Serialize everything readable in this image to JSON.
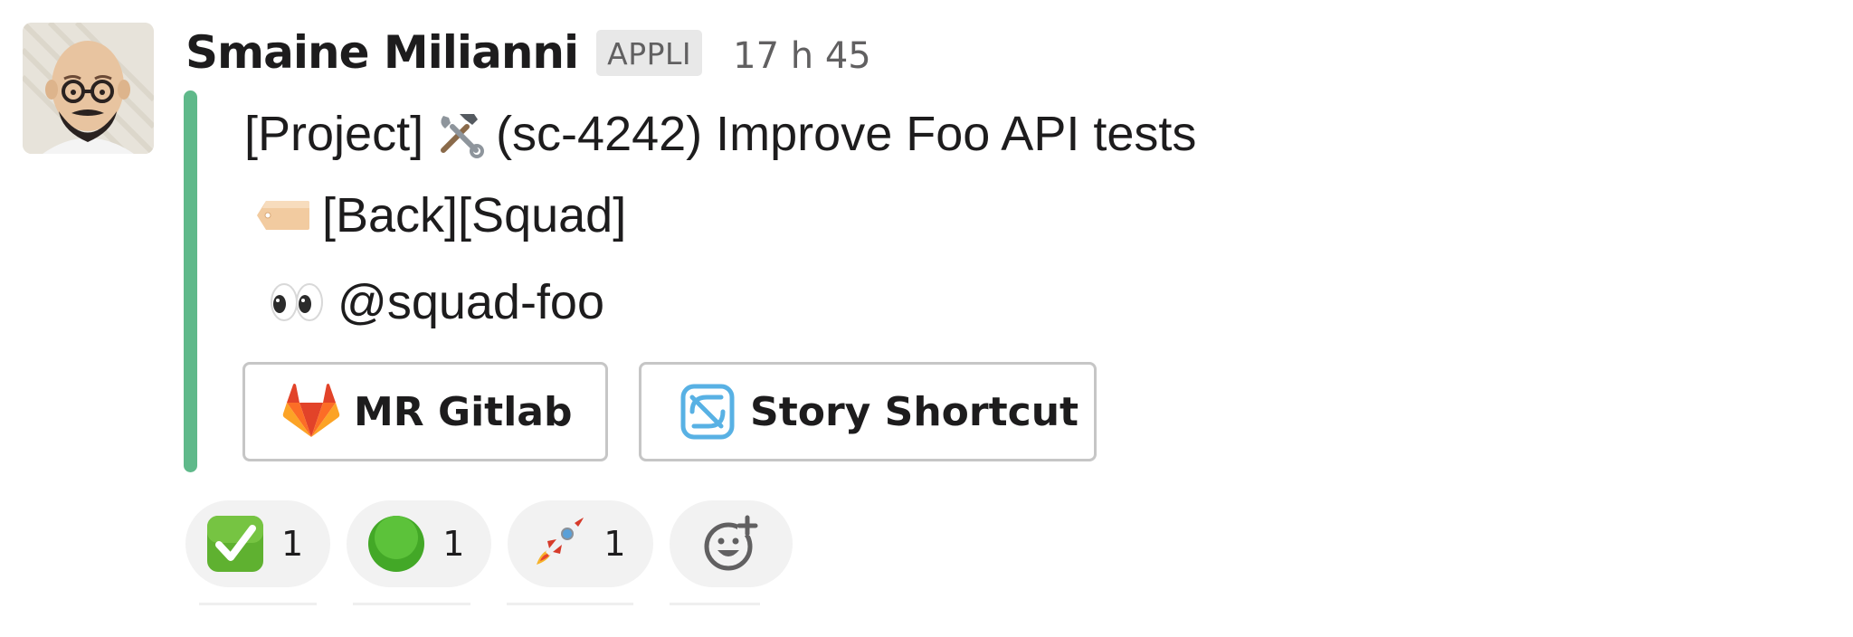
{
  "message": {
    "sender": "Smaine Milianni",
    "badge": "APPLI",
    "timestamp": "17 h 45",
    "avatar_icon": "bald-man-avatar"
  },
  "attachment": {
    "accent_color": "#5fb98a",
    "title_prefix": "[Project]",
    "title_icon": "hammer-and-wrench-icon",
    "title_text": "(sc-4242) Improve Foo API tests",
    "tags_icon": "label-tag-icon",
    "tags_text": "[Back][Squad]",
    "reviewer_icon": "eyes-icon",
    "reviewer_text": "@squad-foo"
  },
  "actions": [
    {
      "label": "MR Gitlab",
      "icon": "gitlab-icon"
    },
    {
      "label": "Story Shortcut",
      "icon": "shortcut-icon"
    }
  ],
  "reactions": [
    {
      "emoji": "check-mark-button-icon",
      "count": "1"
    },
    {
      "emoji": "green-circle-icon",
      "count": "1"
    },
    {
      "emoji": "rocket-icon",
      "count": "1"
    }
  ],
  "add_reaction": {
    "icon": "add-reaction-icon"
  }
}
